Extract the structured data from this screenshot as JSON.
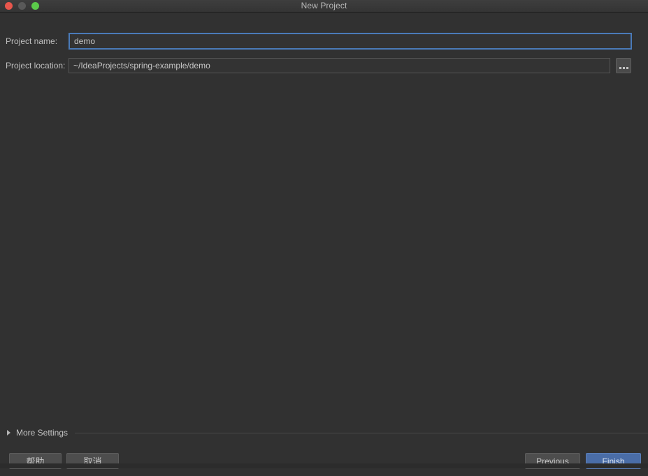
{
  "window": {
    "title": "New Project",
    "traffic_lights": [
      {
        "name": "close",
        "color": "#e8564c"
      },
      {
        "name": "minimize",
        "color": "#595959"
      },
      {
        "name": "zoom",
        "color": "#5bc94a"
      }
    ]
  },
  "form": {
    "project_name": {
      "label": "Project name:",
      "value": "demo",
      "placeholder": ""
    },
    "project_location": {
      "label": "Project location:",
      "value": "~/IdeaProjects/spring-example/demo",
      "placeholder": "",
      "browse_label": "..."
    }
  },
  "more_settings": {
    "label": "More Settings",
    "expanded": false,
    "triangle": "chevron-right-icon"
  },
  "buttons": {
    "help": "帮助",
    "cancel": "取消",
    "previous": "Previous",
    "finish": "Finish"
  },
  "colors": {
    "background": "#313131",
    "titlebar": "#3a3a3a",
    "accent": "#4a6da7",
    "focus_border": "#4a7ab8",
    "text": "#c9c9c9"
  }
}
